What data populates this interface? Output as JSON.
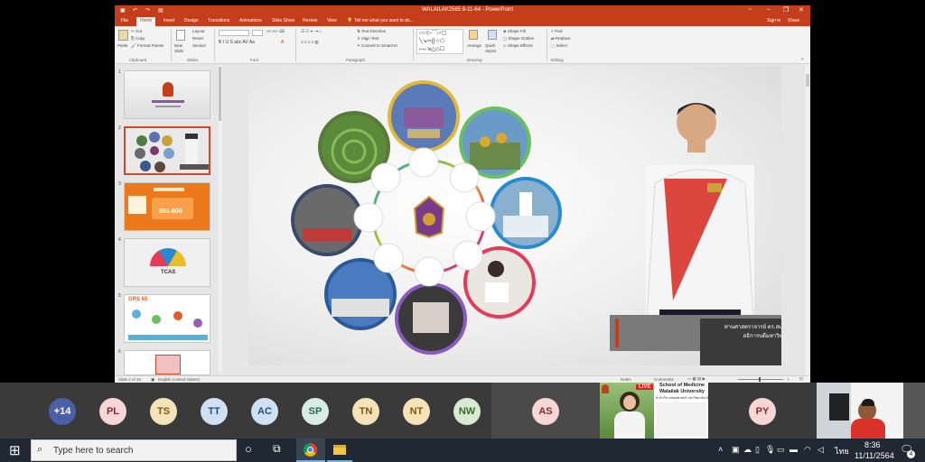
{
  "powerpoint": {
    "title": "WALAILAK2565 8-11-64 - PowerPoint",
    "sign_in": "Sign in",
    "share": "Share",
    "tabs": [
      "File",
      "Home",
      "Insert",
      "Design",
      "Transitions",
      "Animations",
      "Slide Show",
      "Review",
      "View"
    ],
    "tell_me": "Tell me what you want to do...",
    "ribbon": {
      "paste": "Paste",
      "cut": "Cut",
      "copy": "Copy",
      "format_painter": "Format Painter",
      "clipboard": "Clipboard",
      "new_slide": "New Slide",
      "layout": "Layout",
      "reset": "Reset",
      "section": "Section",
      "slides": "Slides",
      "font": "Font",
      "text_direction": "Text Direction",
      "align_text": "Align Text",
      "convert_smartart": "Convert to SmartArt",
      "paragraph": "Paragraph",
      "arrange": "Arrange",
      "quick_styles": "Quick Styles",
      "shape_fill": "Shape Fill",
      "shape_outline": "Shape Outline",
      "shape_effects": "Shape Effects",
      "drawing": "Drawing",
      "find": "Find",
      "replace": "Replace",
      "select": "Select",
      "editing": "Editing"
    },
    "thumb_numbers": [
      "1",
      "2",
      "3",
      "4",
      "5",
      "6"
    ],
    "thumb3_text": "551-600",
    "thumb4_text": "TCAS",
    "thumb5_text": "GRS 65",
    "slide_caption": [
      "ท่านศาสตราจารย์ ดร.สมบ",
      "อธิการบดีมหาวิทย"
    ],
    "status": {
      "slide": "Slide 2 of 34",
      "language": "English (United States)",
      "notes": "Notes",
      "comments": "Comments"
    }
  },
  "participants": [
    {
      "label": "+14",
      "bg": "#4b5fa8",
      "fg": "#ffffff"
    },
    {
      "label": "PL",
      "bg": "#f7d6d6",
      "fg": "#8a2a2a"
    },
    {
      "label": "TS",
      "bg": "#f5e2b8",
      "fg": "#7a5a10"
    },
    {
      "label": "TT",
      "bg": "#cfe0f2",
      "fg": "#2a4e78"
    },
    {
      "label": "AC",
      "bg": "#cfe0f2",
      "fg": "#2a4e78"
    },
    {
      "label": "SP",
      "bg": "#d8ece6",
      "fg": "#2a6650"
    },
    {
      "label": "TN",
      "bg": "#f5e2b8",
      "fg": "#7a5a10"
    },
    {
      "label": "NT",
      "bg": "#f5e2b8",
      "fg": "#7a5a10"
    },
    {
      "label": "NW",
      "bg": "#d9ead3",
      "fg": "#3a6a2a"
    },
    {
      "label": "AS",
      "bg": "#f7d6d6",
      "fg": "#8a2a2a"
    },
    {
      "label": "PY",
      "bg": "#f7d6d6",
      "fg": "#8a2a2a"
    }
  ],
  "live_tile": {
    "live": "LIVE",
    "line1": "School of Medicine",
    "line2": "Walailak University",
    "line3": "สำนักวิชาแพทยศาสตร์ มหาวิทยาลัยวลัยลักษณ์"
  },
  "taskbar": {
    "search_placeholder": "Type here to search",
    "lang": "ไทย",
    "time": "8:36",
    "date": "11/11/2564",
    "notifications": "4"
  },
  "colors": {
    "powerpoint_accent": "#c43e1c",
    "taskbar": "#1f2833",
    "participant_strip": "#3a3a3a"
  }
}
